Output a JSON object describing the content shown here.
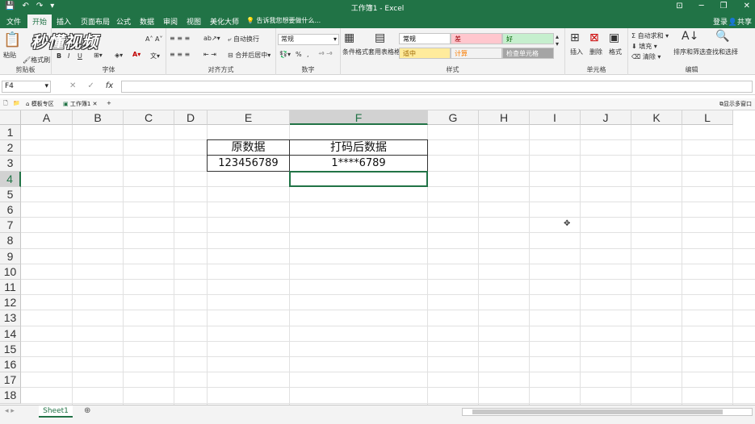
{
  "window": {
    "title": "工作簿1 - Excel"
  },
  "ribbon_tabs": [
    "文件",
    "开始",
    "插入",
    "页面布局",
    "公式",
    "数据",
    "审阅",
    "视图",
    "美化大师"
  ],
  "active_tab": "开始",
  "tell_me": "告诉我您想要做什么...",
  "account": {
    "login": "登录",
    "share": "共享"
  },
  "watermark": "秒懂视频",
  "groups": {
    "clipboard": {
      "label": "剪贴板",
      "paste": "粘贴",
      "format_painter": "格式刷"
    },
    "font": {
      "label": "字体",
      "bold": "B",
      "italic": "I",
      "underline": "U"
    },
    "alignment": {
      "label": "对齐方式",
      "wrap": "自动换行",
      "merge": "合并后居中"
    },
    "number": {
      "label": "数字",
      "format": "常规",
      "percent": "%",
      "comma": ","
    },
    "styles": {
      "label": "样式",
      "cond_format": "条件格式",
      "table_format": "套用表格格式",
      "cells": [
        {
          "name": "常规",
          "bg": "#ffffff",
          "fg": "#000000"
        },
        {
          "name": "差",
          "bg": "#ffc7ce",
          "fg": "#9c0006"
        },
        {
          "name": "好",
          "bg": "#c6efce",
          "fg": "#006100"
        },
        {
          "name": "适中",
          "bg": "#ffeb9c",
          "fg": "#9c6500"
        },
        {
          "name": "计算",
          "bg": "#f2f2f2",
          "fg": "#fa7d00"
        },
        {
          "name": "检查单元格",
          "bg": "#a5a5a5",
          "fg": "#ffffff"
        }
      ]
    },
    "cells": {
      "label": "单元格",
      "insert": "插入",
      "delete": "删除",
      "format": "格式"
    },
    "editing": {
      "label": "编辑",
      "autosum": "自动求和",
      "fill": "填充",
      "clear": "清除",
      "sort": "排序和筛选",
      "find": "查找和选择"
    }
  },
  "formula_bar": {
    "name_box": "F4",
    "fx": "fx",
    "content": ""
  },
  "doc_tabs": {
    "template": "模板专区",
    "workbook": "工作簿1",
    "show_multi": "显示多窗口"
  },
  "columns": [
    "A",
    "B",
    "C",
    "D",
    "E",
    "F",
    "G",
    "H",
    "I",
    "J",
    "K",
    "L"
  ],
  "rows": [
    "1",
    "2",
    "3",
    "4",
    "5",
    "6",
    "7",
    "8",
    "9",
    "10",
    "11",
    "12",
    "13",
    "14",
    "15",
    "16",
    "17",
    "18"
  ],
  "selected": {
    "col": "F",
    "row": "4"
  },
  "table": {
    "headers": [
      "原数据",
      "打码后数据"
    ],
    "values": [
      "123456789",
      "1****6789"
    ]
  },
  "sheets": [
    "Sheet1"
  ],
  "icons": {
    "save": "floppy-icon",
    "undo": "undo-icon",
    "redo": "redo-icon",
    "search": "search-icon",
    "sigma": "sigma-icon"
  }
}
